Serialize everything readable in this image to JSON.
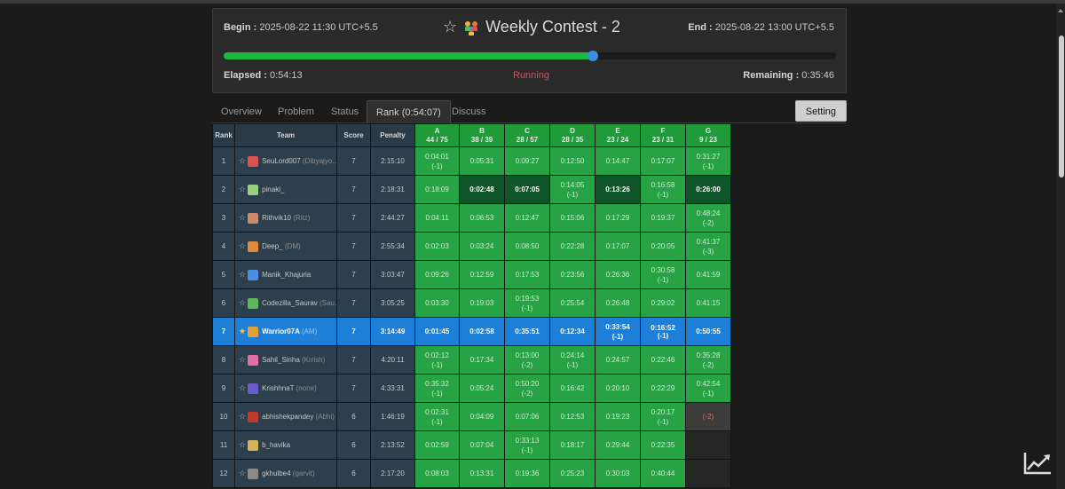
{
  "contest": {
    "begin_label": "Begin :",
    "begin_value": "2025-08-22 11:30 UTC+5.5",
    "end_label": "End :",
    "end_value": "2025-08-22 13:00 UTC+5.5",
    "title": "Weekly Contest - 2",
    "elapsed_label": "Elapsed :",
    "elapsed_value": "0:54:13",
    "status": "Running",
    "remaining_label": "Remaining :",
    "remaining_value": "0:35:46",
    "progress_fraction": 0.603
  },
  "tabs": [
    "Overview",
    "Problem",
    "Status",
    "Rank (0:54:07)",
    "Discuss"
  ],
  "active_tab": "Rank (0:54:07)",
  "setting_label": "Setting",
  "table": {
    "headers": {
      "rank": "Rank",
      "team": "Team",
      "score": "Score",
      "penalty": "Penalty"
    },
    "problems": [
      {
        "id": "A",
        "stat": "44 / 75"
      },
      {
        "id": "B",
        "stat": "38 / 39"
      },
      {
        "id": "C",
        "stat": "28 / 57"
      },
      {
        "id": "D",
        "stat": "28 / 35"
      },
      {
        "id": "E",
        "stat": "23 / 24"
      },
      {
        "id": "F",
        "stat": "23 / 31"
      },
      {
        "id": "G",
        "stat": "9 / 23"
      }
    ],
    "rows": [
      {
        "rank": "1",
        "user": "SeuLord007",
        "alias": "(Dibyajyo…",
        "score": "7",
        "penalty": "2:15:10",
        "avatar": "#d9534f",
        "cells": [
          [
            "0:04:01",
            "(-1)",
            "ac"
          ],
          [
            "0:05:31",
            "",
            "ac"
          ],
          [
            "0:09:27",
            "",
            "ac"
          ],
          [
            "0:12:50",
            "",
            "ac"
          ],
          [
            "0:14:47",
            "",
            "ac"
          ],
          [
            "0:17:07",
            "",
            "ac"
          ],
          [
            "0:31:27",
            "(-1)",
            "ac"
          ]
        ]
      },
      {
        "rank": "2",
        "user": "pinaki_",
        "alias": "",
        "score": "7",
        "penalty": "2:18:31",
        "avatar": "#9ccf7d",
        "cells": [
          [
            "0:18:09",
            "",
            "ac"
          ],
          [
            "0:02:48",
            "",
            "fb"
          ],
          [
            "0:07:05",
            "",
            "fb"
          ],
          [
            "0:14:05",
            "(-1)",
            "ac"
          ],
          [
            "0:13:26",
            "",
            "fb"
          ],
          [
            "0:16:58",
            "(-1)",
            "ac"
          ],
          [
            "0:26:00",
            "",
            "fb"
          ]
        ]
      },
      {
        "rank": "3",
        "user": "Rithvik10",
        "alias": "(Ritz)",
        "score": "7",
        "penalty": "2:44:27",
        "avatar": "#c98b6a",
        "cells": [
          [
            "0:04:11",
            "",
            "ac"
          ],
          [
            "0:06:53",
            "",
            "ac"
          ],
          [
            "0:12:47",
            "",
            "ac"
          ],
          [
            "0:15:06",
            "",
            "ac"
          ],
          [
            "0:17:29",
            "",
            "ac"
          ],
          [
            "0:19:37",
            "",
            "ac"
          ],
          [
            "0:48:24",
            "(-2)",
            "ac"
          ]
        ]
      },
      {
        "rank": "4",
        "user": "Deep_",
        "alias": "(DM)",
        "score": "7",
        "penalty": "2:55:34",
        "avatar": "#e08a3c",
        "cells": [
          [
            "0:02:03",
            "",
            "ac"
          ],
          [
            "0:03:24",
            "",
            "ac"
          ],
          [
            "0:08:50",
            "",
            "ac"
          ],
          [
            "0:22:28",
            "",
            "ac"
          ],
          [
            "0:17:07",
            "",
            "ac"
          ],
          [
            "0:20:05",
            "",
            "ac"
          ],
          [
            "0:41:37",
            "(-3)",
            "ac"
          ]
        ]
      },
      {
        "rank": "5",
        "user": "Manik_Khajuria",
        "alias": "",
        "score": "7",
        "penalty": "3:03:47",
        "avatar": "#4a90e2",
        "cells": [
          [
            "0:09:26",
            "",
            "ac"
          ],
          [
            "0:12:59",
            "",
            "ac"
          ],
          [
            "0:17:53",
            "",
            "ac"
          ],
          [
            "0:23:56",
            "",
            "ac"
          ],
          [
            "0:26:36",
            "",
            "ac"
          ],
          [
            "0:30:58",
            "(-1)",
            "ac"
          ],
          [
            "0:41:59",
            "",
            "ac"
          ]
        ]
      },
      {
        "rank": "6",
        "user": "Codezilla_Saurav",
        "alias": "(Sau…",
        "score": "7",
        "penalty": "3:05:25",
        "avatar": "#5cb85c",
        "cells": [
          [
            "0:03:30",
            "",
            "ac"
          ],
          [
            "0:19:03",
            "",
            "ac"
          ],
          [
            "0:19:53",
            "(-1)",
            "ac"
          ],
          [
            "0:25:54",
            "",
            "ac"
          ],
          [
            "0:26:48",
            "",
            "ac"
          ],
          [
            "0:29:02",
            "",
            "ac"
          ],
          [
            "0:41:15",
            "",
            "ac"
          ]
        ]
      },
      {
        "rank": "7",
        "user": "Warrior07A",
        "alias": "(AM)",
        "score": "7",
        "penalty": "3:14:49",
        "avatar": "#e0a03c",
        "me": true,
        "cells": [
          [
            "0:01:45",
            "",
            "fb"
          ],
          [
            "0:02:58",
            "",
            "ac"
          ],
          [
            "0:35:51",
            "",
            "ac"
          ],
          [
            "0:12:34",
            "",
            "fb"
          ],
          [
            "0:33:54",
            "(-1)",
            "ac"
          ],
          [
            "0:16:52",
            "(-1)",
            "fb"
          ],
          [
            "0:50:55",
            "",
            "ac"
          ]
        ]
      },
      {
        "rank": "8",
        "user": "Sahil_Sinha",
        "alias": "(Krrish)",
        "score": "7",
        "penalty": "4:20:11",
        "avatar": "#e36fa6",
        "cells": [
          [
            "0:02:12",
            "(-1)",
            "ac"
          ],
          [
            "0:17:34",
            "",
            "ac"
          ],
          [
            "0:13:00",
            "(-2)",
            "ac"
          ],
          [
            "0:24:14",
            "(-1)",
            "ac"
          ],
          [
            "0:24:57",
            "",
            "ac"
          ],
          [
            "0:22:46",
            "",
            "ac"
          ],
          [
            "0:35:28",
            "(-2)",
            "ac"
          ]
        ]
      },
      {
        "rank": "9",
        "user": "KrishhnaT",
        "alias": "(none)",
        "score": "7",
        "penalty": "4:33:31",
        "avatar": "#6a5acd",
        "cells": [
          [
            "0:35:32",
            "(-1)",
            "ac"
          ],
          [
            "0:05:24",
            "",
            "ac"
          ],
          [
            "0:50:20",
            "(-2)",
            "ac"
          ],
          [
            "0:16:42",
            "",
            "ac"
          ],
          [
            "0:20:10",
            "",
            "ac"
          ],
          [
            "0:22:29",
            "",
            "ac"
          ],
          [
            "0:42:54",
            "(-1)",
            "ac"
          ]
        ]
      },
      {
        "rank": "10",
        "user": "abhishekpandey",
        "alias": "(Abhi)",
        "score": "6",
        "penalty": "1:46:19",
        "avatar": "#c0392b",
        "cells": [
          [
            "0:02:31",
            "(-1)",
            "ac"
          ],
          [
            "0:04:09",
            "",
            "ac"
          ],
          [
            "0:07:06",
            "",
            "ac"
          ],
          [
            "0:12:53",
            "",
            "ac"
          ],
          [
            "0:19:23",
            "",
            "ac"
          ],
          [
            "0:20:17",
            "(-1)",
            "ac"
          ],
          [
            "(-2)",
            "",
            "wa"
          ]
        ]
      },
      {
        "rank": "11",
        "user": "b_havika",
        "alias": "",
        "score": "6",
        "penalty": "2:13:52",
        "avatar": "#d4b35a",
        "cells": [
          [
            "0:02:59",
            "",
            "ac"
          ],
          [
            "0:07:04",
            "",
            "ac"
          ],
          [
            "0:33:13",
            "(-1)",
            "ac"
          ],
          [
            "0:18:17",
            "",
            "ac"
          ],
          [
            "0:29:44",
            "",
            "ac"
          ],
          [
            "0:22:35",
            "",
            "ac"
          ],
          [
            "",
            "",
            "na"
          ]
        ]
      },
      {
        "rank": "12",
        "user": "gkhulbe4",
        "alias": "(garvit)",
        "score": "6",
        "penalty": "2:17:20",
        "avatar": "#8a8a8a",
        "cells": [
          [
            "0:08:03",
            "",
            "ac"
          ],
          [
            "0:13:31",
            "",
            "ac"
          ],
          [
            "0:19:36",
            "",
            "ac"
          ],
          [
            "0:25:23",
            "",
            "ac"
          ],
          [
            "0:30:03",
            "",
            "ac"
          ],
          [
            "0:40:44",
            "",
            "ac"
          ],
          [
            "",
            "",
            "na"
          ]
        ]
      }
    ]
  },
  "icons": {
    "chart": "trend-chart-icon"
  }
}
